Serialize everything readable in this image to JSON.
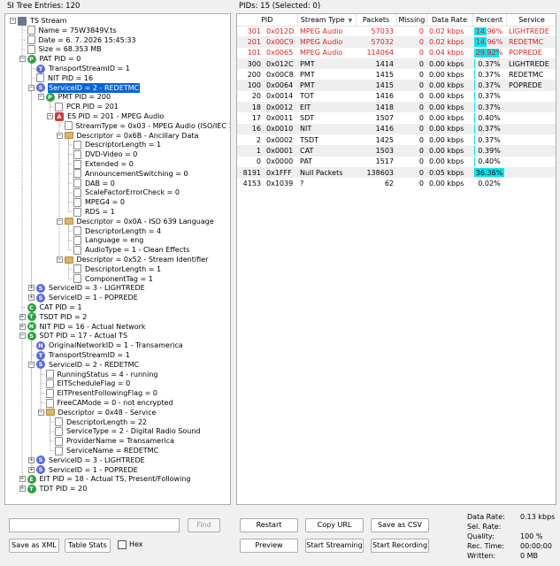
{
  "tree_title": "SI Tree Entries: 120",
  "pids_title": "PIDs: 15   (Selected: 0)",
  "tree": [
    {
      "d": 0,
      "icon": "root",
      "t": "TS Stream",
      "exp": "-"
    },
    {
      "d": 1,
      "icon": "doc",
      "t": "Name = 75W3849V.ts"
    },
    {
      "d": 1,
      "icon": "doc",
      "t": "Date = 6. 7. 2026 15:45:33"
    },
    {
      "d": 1,
      "icon": "doc",
      "t": "Size = 68.353 MB"
    },
    {
      "d": 1,
      "icon": "P",
      "c": "#2ea043",
      "t": "PAT PID = 0",
      "exp": "-"
    },
    {
      "d": 2,
      "icon": "T",
      "c": "#5b6bd6",
      "t": "TransportStreamID = 1"
    },
    {
      "d": 2,
      "icon": "doc",
      "t": "NIT PID = 16"
    },
    {
      "d": 2,
      "icon": "S",
      "c": "#5b6bd6",
      "t": "ServiceID = 2 - REDETMC",
      "exp": "-",
      "sel": true
    },
    {
      "d": 3,
      "icon": "P",
      "c": "#2ea043",
      "t": "PMT PID = 200",
      "exp": "-"
    },
    {
      "d": 4,
      "icon": "doc",
      "t": "PCR PID = 201"
    },
    {
      "d": 4,
      "icon": "A",
      "c": "#d03a3a",
      "sq": true,
      "t": "ES PID = 201 - MPEG Audio",
      "exp": "-"
    },
    {
      "d": 5,
      "icon": "doc",
      "t": "StreamType = 0x03 - MPEG Audio (ISO/IEC 11172)"
    },
    {
      "d": 5,
      "icon": "fold",
      "t": "Descriptor = 0x6B - Ancillary Data",
      "exp": "-"
    },
    {
      "d": 6,
      "icon": "doc",
      "t": "DescriptorLength = 1"
    },
    {
      "d": 6,
      "icon": "doc",
      "t": "DVD-Video = 0"
    },
    {
      "d": 6,
      "icon": "doc",
      "t": "Extended = 0"
    },
    {
      "d": 6,
      "icon": "doc",
      "t": "AnnouncementSwitching = 0"
    },
    {
      "d": 6,
      "icon": "doc",
      "t": "DAB = 0"
    },
    {
      "d": 6,
      "icon": "doc",
      "t": "ScaleFactorErrorCheck = 0"
    },
    {
      "d": 6,
      "icon": "doc",
      "t": "MPEG4 = 0"
    },
    {
      "d": 6,
      "icon": "doc",
      "t": "RDS = 1"
    },
    {
      "d": 5,
      "icon": "fold",
      "t": "Descriptor = 0x0A - ISO 639 Language",
      "exp": "-"
    },
    {
      "d": 6,
      "icon": "doc",
      "t": "DescriptorLength = 4"
    },
    {
      "d": 6,
      "icon": "doc",
      "t": "Language = eng"
    },
    {
      "d": 6,
      "icon": "doc",
      "t": "AudioType = 1 - Clean Effects"
    },
    {
      "d": 5,
      "icon": "fold",
      "t": "Descriptor = 0x52 - Stream Identifier",
      "exp": "-"
    },
    {
      "d": 6,
      "icon": "doc",
      "t": "DescriptorLength = 1"
    },
    {
      "d": 6,
      "icon": "doc",
      "t": "ComponentTag = 1"
    },
    {
      "d": 2,
      "icon": "S",
      "c": "#5b6bd6",
      "t": "ServiceID = 3 - LIGHTREDE",
      "exp": "+"
    },
    {
      "d": 2,
      "icon": "S",
      "c": "#5b6bd6",
      "t": "ServiceID = 1 - POPREDE",
      "exp": "+"
    },
    {
      "d": 1,
      "icon": "C",
      "c": "#2ea043",
      "t": "CAT PID = 1"
    },
    {
      "d": 1,
      "icon": "T",
      "c": "#2ea043",
      "t": "TSDT PID = 2",
      "exp": "+"
    },
    {
      "d": 1,
      "icon": "N",
      "c": "#2ea043",
      "t": "NIT PID = 16 - Actual Network",
      "exp": "+"
    },
    {
      "d": 1,
      "icon": "S",
      "c": "#2ea043",
      "t": "SDT PID = 17 - Actual TS",
      "exp": "-"
    },
    {
      "d": 2,
      "icon": "N",
      "c": "#5b6bd6",
      "t": "OriginalNetworkID = 1 - Transamerica"
    },
    {
      "d": 2,
      "icon": "T",
      "c": "#5b6bd6",
      "t": "TransportStreamID = 1"
    },
    {
      "d": 2,
      "icon": "S",
      "c": "#5b6bd6",
      "t": "ServiceID = 2 - REDETMC",
      "exp": "-"
    },
    {
      "d": 3,
      "icon": "doc",
      "t": "RunningStatus = 4 - running"
    },
    {
      "d": 3,
      "icon": "doc",
      "t": "EITScheduleFlag = 0"
    },
    {
      "d": 3,
      "icon": "doc",
      "t": "EITPresentFollowingFlag = 0"
    },
    {
      "d": 3,
      "icon": "doc",
      "t": "FreeCAMode = 0 - not encrypted"
    },
    {
      "d": 3,
      "icon": "fold",
      "t": "Descriptor = 0x48 - Service",
      "exp": "-"
    },
    {
      "d": 4,
      "icon": "doc",
      "t": "DescriptorLength = 22"
    },
    {
      "d": 4,
      "icon": "doc",
      "t": "ServiceType = 2 - Digital Radio Sound"
    },
    {
      "d": 4,
      "icon": "doc",
      "t": "ProviderName = Transamerica"
    },
    {
      "d": 4,
      "icon": "doc",
      "t": "ServiceName = REDETMC"
    },
    {
      "d": 2,
      "icon": "S",
      "c": "#5b6bd6",
      "t": "ServiceID = 3 - LIGHTREDE",
      "exp": "+"
    },
    {
      "d": 2,
      "icon": "S",
      "c": "#5b6bd6",
      "t": "ServiceID = 1 - POPREDE",
      "exp": "+"
    },
    {
      "d": 1,
      "icon": "E",
      "c": "#2ea043",
      "t": "EIT PID = 18 - Actual TS, Present/Following",
      "exp": "+"
    },
    {
      "d": 1,
      "icon": "T",
      "c": "#2ea043",
      "t": "TDT PID = 20",
      "exp": "+"
    }
  ],
  "columns": [
    "PID",
    "Stream Type",
    "Packets",
    "Missing",
    "Data Rate",
    "Percent",
    "Service"
  ],
  "rows": [
    {
      "pid": "301",
      "hex": "0x012D",
      "type": "MPEG Audio",
      "packets": "57033",
      "missing": "0",
      "rate": "0.02 kbps",
      "pct": 14.96,
      "pct_label": "14.96%",
      "service": "LIGHTREDE",
      "red": true
    },
    {
      "pid": "201",
      "hex": "0x00C9",
      "type": "MPEG Audio",
      "packets": "57032",
      "missing": "0",
      "rate": "0.02 kbps",
      "pct": 14.96,
      "pct_label": "14.96%",
      "service": "REDETMC",
      "red": true
    },
    {
      "pid": "101",
      "hex": "0x0065",
      "type": "MPEG Audio",
      "packets": "114064",
      "missing": "0",
      "rate": "0.04 kbps",
      "pct": 29.92,
      "pct_label": "29.92%",
      "service": "POPREDE",
      "red": true
    },
    {
      "pid": "300",
      "hex": "0x012C",
      "type": "PMT",
      "packets": "1414",
      "missing": "0",
      "rate": "0.00 kbps",
      "pct": 0.37,
      "pct_label": "0.37%",
      "service": "LIGHTREDE"
    },
    {
      "pid": "200",
      "hex": "0x00C8",
      "type": "PMT",
      "packets": "1415",
      "missing": "0",
      "rate": "0.00 kbps",
      "pct": 0.37,
      "pct_label": "0.37%",
      "service": "REDETMC"
    },
    {
      "pid": "100",
      "hex": "0x0064",
      "type": "PMT",
      "packets": "1415",
      "missing": "0",
      "rate": "0.00 kbps",
      "pct": 0.37,
      "pct_label": "0.37%",
      "service": "POPREDE"
    },
    {
      "pid": "20",
      "hex": "0x0014",
      "type": "TOT",
      "packets": "1416",
      "missing": "0",
      "rate": "0.00 kbps",
      "pct": 0.37,
      "pct_label": "0.37%",
      "service": ""
    },
    {
      "pid": "18",
      "hex": "0x0012",
      "type": "EIT",
      "packets": "1418",
      "missing": "0",
      "rate": "0.00 kbps",
      "pct": 0.37,
      "pct_label": "0.37%",
      "service": ""
    },
    {
      "pid": "17",
      "hex": "0x0011",
      "type": "SDT",
      "packets": "1507",
      "missing": "0",
      "rate": "0.00 kbps",
      "pct": 0.4,
      "pct_label": "0.40%",
      "service": ""
    },
    {
      "pid": "16",
      "hex": "0x0010",
      "type": "NIT",
      "packets": "1416",
      "missing": "0",
      "rate": "0.00 kbps",
      "pct": 0.37,
      "pct_label": "0.37%",
      "service": ""
    },
    {
      "pid": "2",
      "hex": "0x0002",
      "type": "TSDT",
      "packets": "1425",
      "missing": "0",
      "rate": "0.00 kbps",
      "pct": 0.37,
      "pct_label": "0.37%",
      "service": ""
    },
    {
      "pid": "1",
      "hex": "0x0001",
      "type": "CAT",
      "packets": "1503",
      "missing": "0",
      "rate": "0.00 kbps",
      "pct": 0.39,
      "pct_label": "0.39%",
      "service": ""
    },
    {
      "pid": "0",
      "hex": "0x0000",
      "type": "PAT",
      "packets": "1517",
      "missing": "0",
      "rate": "0.00 kbps",
      "pct": 0.4,
      "pct_label": "0.40%",
      "service": ""
    },
    {
      "pid": "8191",
      "hex": "0x1FFF",
      "type": "Null Packets",
      "packets": "138603",
      "missing": "0",
      "rate": "0.05 kbps",
      "pct": 36.36,
      "pct_label": "36.36%",
      "service": ""
    },
    {
      "pid": "4153",
      "hex": "0x1039",
      "type": "?",
      "packets": "62",
      "missing": "0",
      "rate": "0.00 kbps",
      "pct": 0.02,
      "pct_label": "0.02%",
      "service": ""
    }
  ],
  "buttons": {
    "find": "Find",
    "save_xml": "Save as XML",
    "table_stats": "Table Stats",
    "hex": "Hex",
    "restart": "Restart",
    "copy_url": "Copy URL",
    "save_csv": "Save as CSV",
    "preview": "Preview",
    "start_streaming": "Start Streaming",
    "start_recording": "Start Recording"
  },
  "find_value": "",
  "stats": [
    {
      "k": "Data Rate:",
      "v": "0.13 kbps"
    },
    {
      "k": "Sel. Rate:",
      "v": ""
    },
    {
      "k": "Quality:",
      "v": "100 %"
    },
    {
      "k": "Rec. Time:",
      "v": "00:00:00"
    },
    {
      "k": "Written:",
      "v": "0 MB"
    }
  ],
  "colors": {
    "selection": "#0a64d6",
    "percent_bar": "#00e6f0",
    "red_text": "#e02020"
  }
}
